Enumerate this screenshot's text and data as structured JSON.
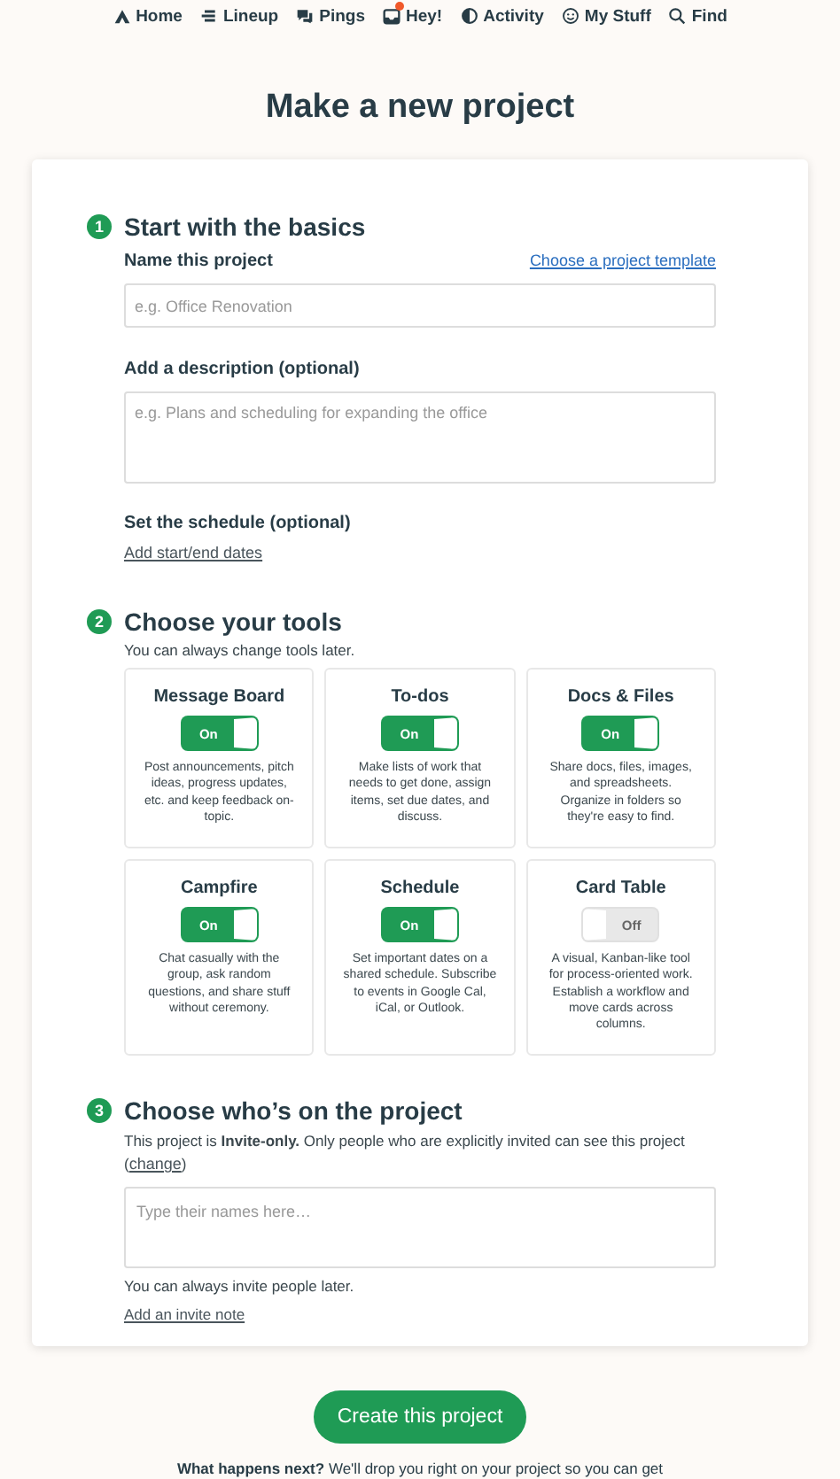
{
  "nav": [
    {
      "label": "Home",
      "kind": "home",
      "notification": false
    },
    {
      "label": "Lineup",
      "kind": "lineup",
      "notification": false
    },
    {
      "label": "Pings",
      "kind": "pings",
      "notification": false
    },
    {
      "label": "Hey!",
      "kind": "hey",
      "notification": true
    },
    {
      "label": "Activity",
      "kind": "activity",
      "notification": false
    },
    {
      "label": "My Stuff",
      "kind": "mystuff",
      "notification": false
    },
    {
      "label": "Find",
      "kind": "find",
      "notification": false
    }
  ],
  "title": "Make a new project",
  "basics": {
    "number": "1",
    "heading": "Start with the basics",
    "name_label": "Name this project",
    "template_link": "Choose a project template",
    "name_placeholder": "e.g. Office Renovation",
    "description_label": "Add a description (optional)",
    "description_placeholder": "e.g. Plans and scheduling for expanding the office",
    "schedule_label": "Set the schedule (optional)",
    "schedule_link": "Add start/end dates"
  },
  "tools_section": {
    "number": "2",
    "heading": "Choose your tools",
    "subtitle": "You can always change tools later.",
    "tools": [
      {
        "name": "Message Board",
        "on": true,
        "toggle_label": "On",
        "description": "Post announcements, pitch ideas, progress updates, etc. and keep feedback on-topic."
      },
      {
        "name": "To-dos",
        "on": true,
        "toggle_label": "On",
        "description": "Make lists of work that needs to get done, assign items, set due dates, and discuss."
      },
      {
        "name": "Docs & Files",
        "on": true,
        "toggle_label": "On",
        "description": "Share docs, files, images, and spreadsheets. Organize in folders so they're easy to find."
      },
      {
        "name": "Campfire",
        "on": true,
        "toggle_label": "On",
        "description": "Chat casually with the group, ask random questions, and share stuff without ceremony."
      },
      {
        "name": "Schedule",
        "on": true,
        "toggle_label": "On",
        "description": "Set important dates on a shared schedule. Subscribe to events in Google Cal, iCal, or Outlook."
      },
      {
        "name": "Card Table",
        "on": false,
        "toggle_label": "Off",
        "description": "A visual, Kanban-like tool for process-oriented work. Establish a workflow and move cards across columns."
      }
    ]
  },
  "people": {
    "number": "3",
    "heading": "Choose who’s on the project",
    "access_text": "This project is **Invite-only.** Only people who are explicitly invited can see this project (",
    "change_link": "change",
    "access_end": ")",
    "names_placeholder": "Type their names here…",
    "note": "You can always invite people later.",
    "invite_note_link": "Add an invite note"
  },
  "create_button": "Create this project",
  "next_text": "**What happens next?** We'll drop you right on your project so you can get"
}
